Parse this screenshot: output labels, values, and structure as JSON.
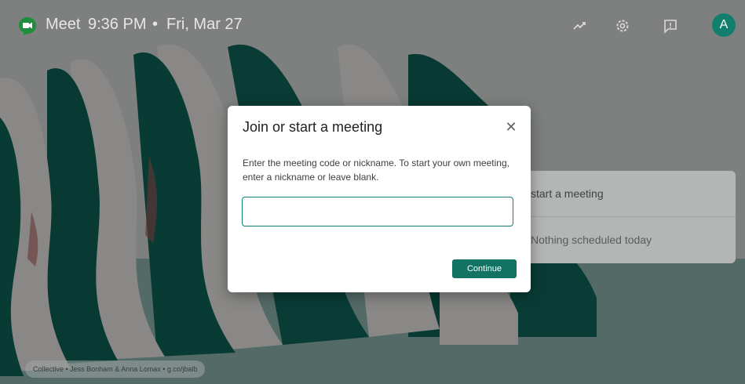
{
  "header": {
    "brand": "Meet",
    "time": "9:36 PM",
    "separator": "•",
    "date": "Fri, Mar 27",
    "avatar_letter": "A",
    "icons": [
      "meet-logo-icon",
      "trending-icon",
      "settings-icon",
      "feedback-icon"
    ]
  },
  "side_card": {
    "item1": "start a meeting",
    "item2": "Nothing scheduled today"
  },
  "modal": {
    "title": "Join or start a meeting",
    "close": "✕",
    "description": "Enter the meeting code or nickname. To start your own meeting, enter a nickname or leave blank.",
    "input_value": "",
    "continue_label": "Continue"
  },
  "credit": "Collective • Jess Bonham & Anna Lomax • g.co/jbalb",
  "colors": {
    "accent": "#127f6e",
    "button": "#137363",
    "art_green": "#10685c",
    "art_white": "#ecebe7"
  }
}
